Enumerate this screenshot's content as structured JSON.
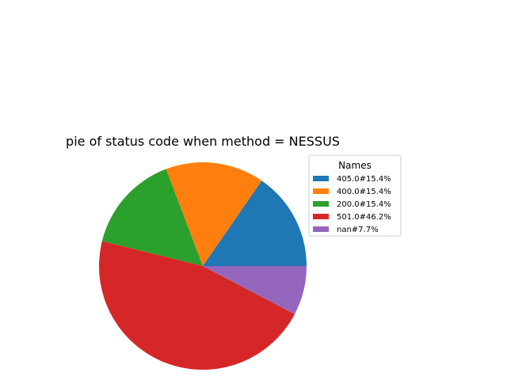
{
  "chart_data": {
    "type": "pie",
    "title": "pie of status code when method = NESSUS",
    "legend": {
      "title": "Names",
      "placement": "right"
    },
    "categories": [
      "405.0#15.4%",
      "400.0#15.4%",
      "200.0#15.4%",
      "501.0#46.2%",
      "nan#7.7%"
    ],
    "values": [
      15.4,
      15.4,
      15.4,
      46.2,
      7.7
    ],
    "colors": [
      "#1f77b4",
      "#ff7f0e",
      "#2ca02c",
      "#d62728",
      "#9467bd"
    ],
    "start_angle_deg": 0,
    "direction": "counterclockwise"
  }
}
